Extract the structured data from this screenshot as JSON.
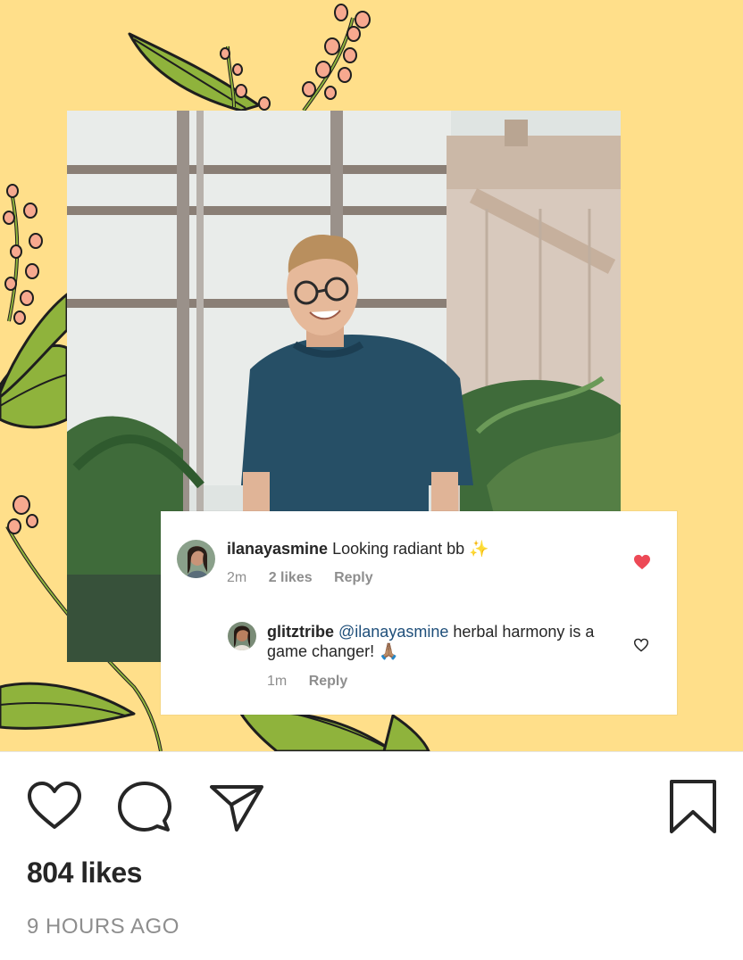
{
  "post": {
    "likes_text": "804 likes",
    "timestamp": "9 HOURS AGO"
  },
  "comments": [
    {
      "username": "ilanayasmine",
      "text": "Looking radiant bb",
      "emoji": "✨",
      "age": "2m",
      "likes": "2 likes",
      "reply_label": "Reply",
      "liked": true
    },
    {
      "username": "glitztribe",
      "mention": "@ilanayasmine",
      "text": "herbal harmony is a game changer!",
      "emoji": "🙏🏽",
      "age": "1m",
      "reply_label": "Reply",
      "liked": false
    }
  ],
  "icons": {
    "like": "heart-outline-icon",
    "comment": "comment-bubble-icon",
    "share": "paper-plane-icon",
    "save": "bookmark-icon",
    "comment_liked": "heart-filled-icon",
    "comment_unliked": "heart-outline-icon"
  },
  "colors": {
    "background": "#ffdf8a",
    "leaf": "#8fb33c",
    "flower": "#f7a98f",
    "liked_heart": "#ed4956",
    "mention": "#1f4f7a",
    "secondary_text": "#8e8e8e"
  }
}
